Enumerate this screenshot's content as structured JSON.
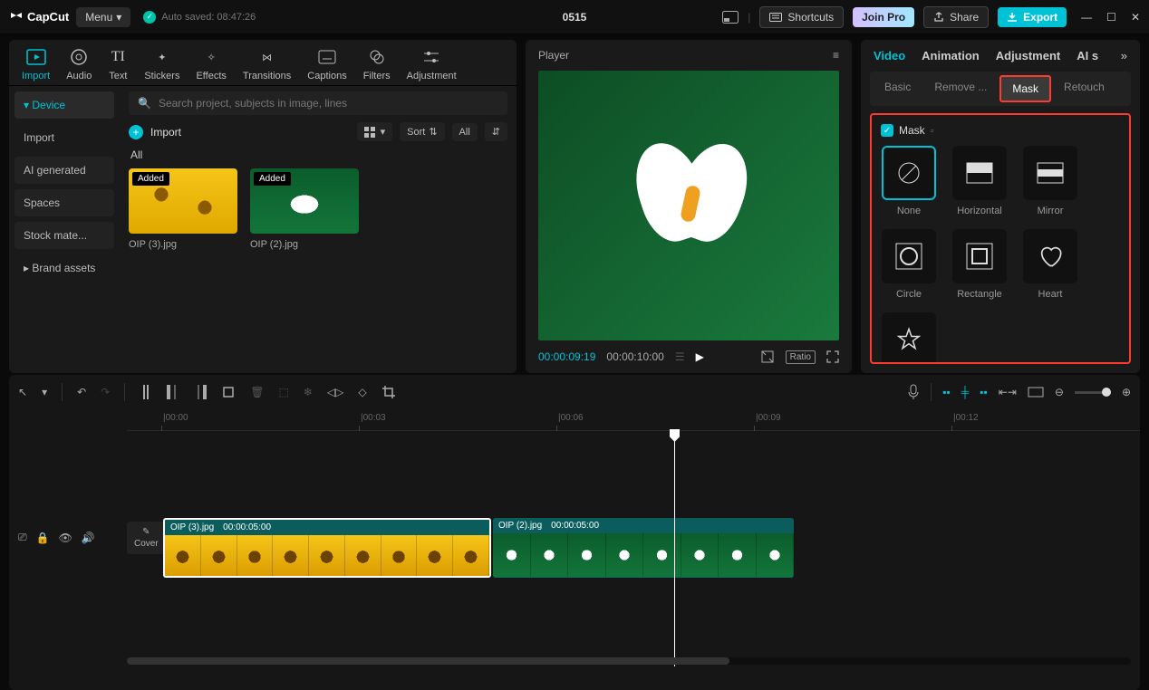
{
  "app": {
    "name": "CapCut",
    "menu": "Menu",
    "autosave": "Auto saved: 08:47:26",
    "title": "0515"
  },
  "topbar": {
    "shortcuts": "Shortcuts",
    "joinpro": "Join Pro",
    "share": "Share",
    "export": "Export"
  },
  "left": {
    "tabs": [
      "Import",
      "Audio",
      "Text",
      "Stickers",
      "Effects",
      "Transitions",
      "Captions",
      "Filters",
      "Adjustment"
    ],
    "sidebar": {
      "device": "Device",
      "import": "Import",
      "ai": "AI generated",
      "spaces": "Spaces",
      "stock": "Stock mate...",
      "brand": "Brand assets"
    },
    "search_placeholder": "Search project, subjects in image, lines",
    "import_btn": "Import",
    "sort": "Sort",
    "all": "All",
    "section": "All",
    "thumbs": [
      {
        "badge": "Added",
        "name": "OIP (3).jpg"
      },
      {
        "badge": "Added",
        "name": "OIP (2).jpg"
      }
    ]
  },
  "player": {
    "label": "Player",
    "time_cur": "00:00:09:19",
    "time_total": "00:00:10:00",
    "ratio": "Ratio"
  },
  "right": {
    "tabs": [
      "Video",
      "Animation",
      "Adjustment",
      "AI s"
    ],
    "subtabs": [
      "Basic",
      "Remove ...",
      "Mask",
      "Retouch"
    ],
    "mask_label": "Mask",
    "masks": [
      "None",
      "Horizontal",
      "Mirror",
      "Circle",
      "Rectangle",
      "Heart"
    ]
  },
  "timeline": {
    "ticks": [
      "|00:00",
      "|00:03",
      "|00:06",
      "|00:09",
      "|00:12"
    ],
    "cover": "Cover",
    "clips": [
      {
        "name": "OIP (3).jpg",
        "dur": "00:00:05:00"
      },
      {
        "name": "OIP (2).jpg",
        "dur": "00:00:05:00"
      }
    ]
  }
}
